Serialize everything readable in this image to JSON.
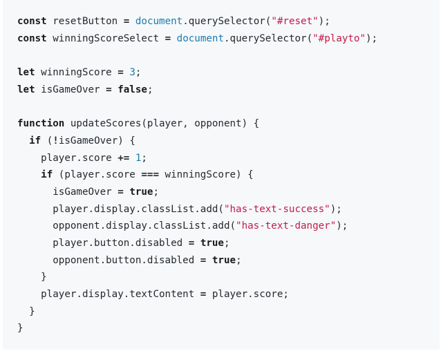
{
  "code": {
    "lines": [
      [
        {
          "t": "const",
          "k": "kw"
        },
        {
          "t": " resetButton ",
          "k": "plain"
        },
        {
          "t": "=",
          "k": "op"
        },
        {
          "t": " ",
          "k": "plain"
        },
        {
          "t": "document",
          "k": "builtin"
        },
        {
          "t": ".querySelector(",
          "k": "plain"
        },
        {
          "t": "\"#reset\"",
          "k": "str"
        },
        {
          "t": ");",
          "k": "punc"
        }
      ],
      [
        {
          "t": "const",
          "k": "kw"
        },
        {
          "t": " winningScoreSelect ",
          "k": "plain"
        },
        {
          "t": "=",
          "k": "op"
        },
        {
          "t": " ",
          "k": "plain"
        },
        {
          "t": "document",
          "k": "builtin"
        },
        {
          "t": ".querySelector(",
          "k": "plain"
        },
        {
          "t": "\"#playto\"",
          "k": "str"
        },
        {
          "t": ");",
          "k": "punc"
        }
      ],
      [],
      [
        {
          "t": "let",
          "k": "kw"
        },
        {
          "t": " winningScore ",
          "k": "plain"
        },
        {
          "t": "=",
          "k": "op"
        },
        {
          "t": " ",
          "k": "plain"
        },
        {
          "t": "3",
          "k": "num"
        },
        {
          "t": ";",
          "k": "punc"
        }
      ],
      [
        {
          "t": "let",
          "k": "kw"
        },
        {
          "t": " isGameOver ",
          "k": "plain"
        },
        {
          "t": "=",
          "k": "op"
        },
        {
          "t": " ",
          "k": "plain"
        },
        {
          "t": "false",
          "k": "kw"
        },
        {
          "t": ";",
          "k": "punc"
        }
      ],
      [],
      [
        {
          "t": "function",
          "k": "kw"
        },
        {
          "t": " updateScores(player, opponent) {",
          "k": "plain"
        }
      ],
      [
        {
          "t": "  ",
          "k": "plain"
        },
        {
          "t": "if",
          "k": "kw"
        },
        {
          "t": " (",
          "k": "plain"
        },
        {
          "t": "!",
          "k": "op"
        },
        {
          "t": "isGameOver) {",
          "k": "plain"
        }
      ],
      [
        {
          "t": "    player.score ",
          "k": "plain"
        },
        {
          "t": "+=",
          "k": "op"
        },
        {
          "t": " ",
          "k": "plain"
        },
        {
          "t": "1",
          "k": "num"
        },
        {
          "t": ";",
          "k": "punc"
        }
      ],
      [
        {
          "t": "    ",
          "k": "plain"
        },
        {
          "t": "if",
          "k": "kw"
        },
        {
          "t": " (player.score ",
          "k": "plain"
        },
        {
          "t": "===",
          "k": "op"
        },
        {
          "t": " winningScore) {",
          "k": "plain"
        }
      ],
      [
        {
          "t": "      isGameOver ",
          "k": "plain"
        },
        {
          "t": "=",
          "k": "op"
        },
        {
          "t": " ",
          "k": "plain"
        },
        {
          "t": "true",
          "k": "kw"
        },
        {
          "t": ";",
          "k": "punc"
        }
      ],
      [
        {
          "t": "      player.display.classList.add(",
          "k": "plain"
        },
        {
          "t": "\"has-text-success\"",
          "k": "str"
        },
        {
          "t": ");",
          "k": "punc"
        }
      ],
      [
        {
          "t": "      opponent.display.classList.add(",
          "k": "plain"
        },
        {
          "t": "\"has-text-danger\"",
          "k": "str"
        },
        {
          "t": ");",
          "k": "punc"
        }
      ],
      [
        {
          "t": "      player.button.disabled ",
          "k": "plain"
        },
        {
          "t": "=",
          "k": "op"
        },
        {
          "t": " ",
          "k": "plain"
        },
        {
          "t": "true",
          "k": "kw"
        },
        {
          "t": ";",
          "k": "punc"
        }
      ],
      [
        {
          "t": "      opponent.button.disabled ",
          "k": "plain"
        },
        {
          "t": "=",
          "k": "op"
        },
        {
          "t": " ",
          "k": "plain"
        },
        {
          "t": "true",
          "k": "kw"
        },
        {
          "t": ";",
          "k": "punc"
        }
      ],
      [
        {
          "t": "    }",
          "k": "plain"
        }
      ],
      [
        {
          "t": "    player.display.textContent ",
          "k": "plain"
        },
        {
          "t": "=",
          "k": "op"
        },
        {
          "t": " player.score;",
          "k": "plain"
        }
      ],
      [
        {
          "t": "  }",
          "k": "plain"
        }
      ],
      [
        {
          "t": "}",
          "k": "plain"
        }
      ]
    ]
  },
  "colors": {
    "background": "#f6f8fa",
    "keyword": "#1a1a1a",
    "string": "#c41a4a",
    "number": "#1c7cab",
    "builtin": "#1c7cab",
    "text": "#24292e"
  }
}
